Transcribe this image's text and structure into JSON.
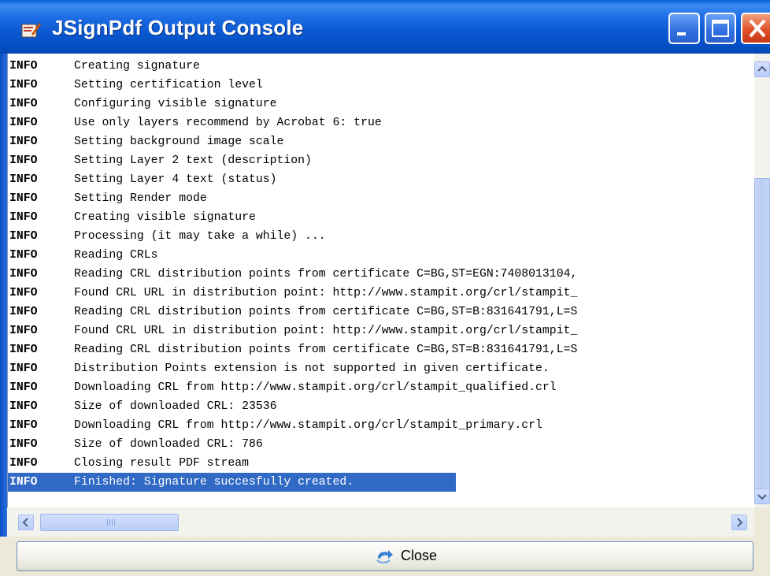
{
  "window": {
    "title": "JSignPdf Output Console",
    "title_icon": "jsignpdf-app-icon",
    "controls": {
      "minimize_icon": "minimize-icon",
      "maximize_icon": "maximize-icon",
      "close_icon": "close-window-icon"
    }
  },
  "console": {
    "lines": [
      {
        "level": "INFO",
        "message": "Creating signature"
      },
      {
        "level": "INFO",
        "message": "Setting certification level"
      },
      {
        "level": "INFO",
        "message": "Configuring visible signature"
      },
      {
        "level": "INFO",
        "message": "Use only layers recommend by Acrobat 6: true"
      },
      {
        "level": "INFO",
        "message": "Setting background image scale"
      },
      {
        "level": "INFO",
        "message": "Setting Layer 2 text (description)"
      },
      {
        "level": "INFO",
        "message": "Setting Layer 4 text (status)"
      },
      {
        "level": "INFO",
        "message": "Setting Render mode"
      },
      {
        "level": "INFO",
        "message": "Creating visible signature"
      },
      {
        "level": "INFO",
        "message": "Processing (it may take a while) ..."
      },
      {
        "level": "INFO",
        "message": "Reading CRLs"
      },
      {
        "level": "INFO",
        "message": "Reading CRL distribution points from certificate C=BG,ST=EGN:7408013104,"
      },
      {
        "level": "INFO",
        "message": "Found CRL URL in distribution point: http://www.stampit.org/crl/stampit_"
      },
      {
        "level": "INFO",
        "message": "Reading CRL distribution points from certificate C=BG,ST=B:831641791,L=S"
      },
      {
        "level": "INFO",
        "message": "Found CRL URL in distribution point: http://www.stampit.org/crl/stampit_"
      },
      {
        "level": "INFO",
        "message": "Reading CRL distribution points from certificate C=BG,ST=B:831641791,L=S"
      },
      {
        "level": "INFO",
        "message": "Distribution Points extension is not supported in given certificate."
      },
      {
        "level": "INFO",
        "message": "Downloading CRL from http://www.stampit.org/crl/stampit_qualified.crl"
      },
      {
        "level": "INFO",
        "message": "Size of downloaded CRL: 23536"
      },
      {
        "level": "INFO",
        "message": "Downloading CRL from http://www.stampit.org/crl/stampit_primary.crl"
      },
      {
        "level": "INFO",
        "message": "Size of downloaded CRL: 786"
      },
      {
        "level": "INFO",
        "message": "Closing result PDF stream"
      },
      {
        "level": "INFO",
        "message": "Finished: Signature succesfully created.",
        "selected": true
      }
    ],
    "selection_color": "#316ac5"
  },
  "scrollbars": {
    "vertical": {
      "up_icon": "scroll-up-arrow-icon",
      "down_icon": "scroll-down-arrow-icon"
    },
    "horizontal": {
      "left_icon": "scroll-left-arrow-icon",
      "right_icon": "scroll-right-arrow-icon"
    }
  },
  "footer": {
    "close_button_label": "Close",
    "close_button_icon": "close-arrow-icon"
  },
  "colors": {
    "title_bar": "#0a58d0",
    "window_bg": "#ece9d8",
    "close_window_button": "#e0502a"
  }
}
